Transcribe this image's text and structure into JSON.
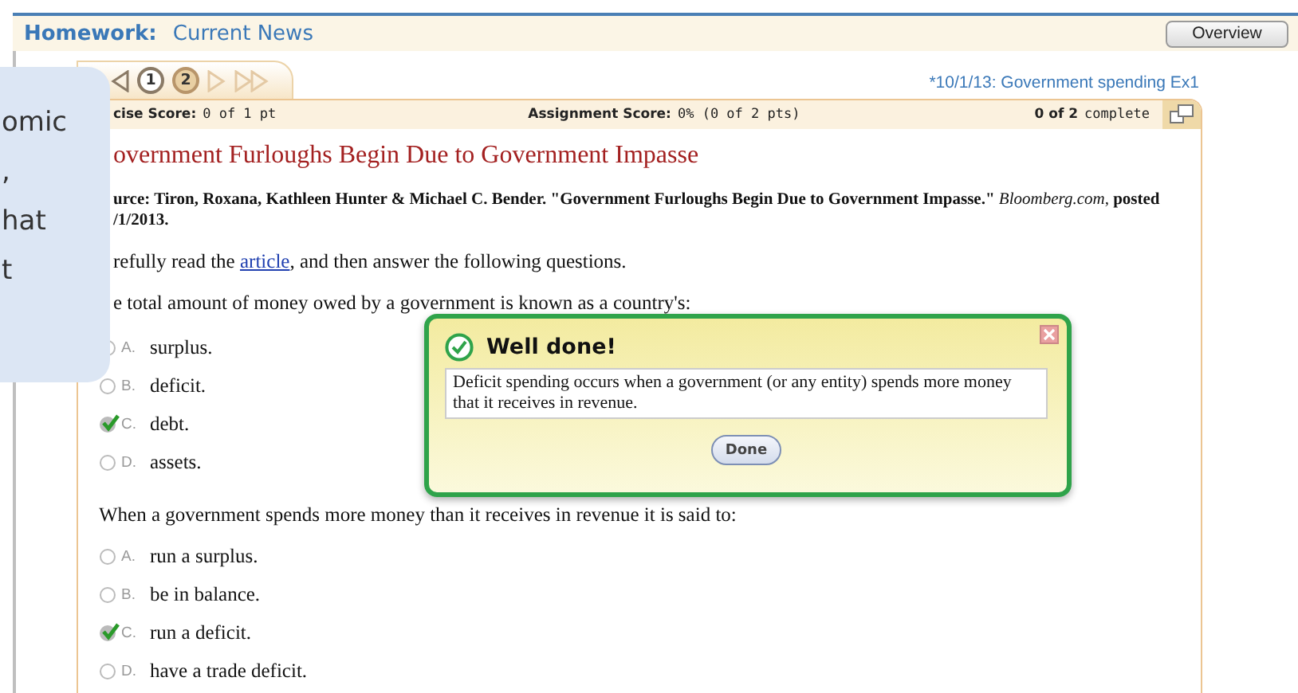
{
  "header": {
    "label": "Homework:",
    "title": "Current News",
    "button": "Overview"
  },
  "nav": {
    "pages": [
      {
        "label": "1",
        "selected": false
      },
      {
        "label": "2",
        "selected": true
      }
    ],
    "link": "*10/1/13: Government spending Ex1"
  },
  "score_bar": {
    "exercise_label": "cise Score:",
    "exercise_value": "0 of 1 pt",
    "assignment_label": "Assignment Score:",
    "assignment_value": "0% (0 of 2 pts)",
    "complete_count": "0 of 2",
    "complete_label": "complete"
  },
  "article": {
    "title": "overnment Furloughs Begin Due to Government Impasse",
    "source": "**urce: Tiron, Roxana, Kathleen Hunter & Michael C. Bender. \"Government Furloughs Begin Due to Government Impasse.\"** *Bloomberg.com*, **posted**",
    "source_date": "/1/2013.",
    "intro_before": "refully read the",
    "intro_link": "article",
    "intro_after": ", and then answer the following questions."
  },
  "questions": [
    {
      "prompt": "e total amount of money owed by a government is known as a country's:",
      "options": [
        {
          "letter": "A.",
          "text": "surplus.",
          "selected": false
        },
        {
          "letter": "B.",
          "text": "deficit.",
          "selected": false
        },
        {
          "letter": "C.",
          "text": "debt.",
          "selected": true
        },
        {
          "letter": "D.",
          "text": "assets.",
          "selected": false
        }
      ]
    },
    {
      "prompt": "When a government spends more money than it receives in revenue it is said to:",
      "options": [
        {
          "letter": "A.",
          "text": "run a surplus.",
          "selected": false
        },
        {
          "letter": "B.",
          "text": "be in balance.",
          "selected": false
        },
        {
          "letter": "C.",
          "text": "run a deficit.",
          "selected": true
        },
        {
          "letter": "D.",
          "text": "have a trade deficit.",
          "selected": false
        }
      ]
    }
  ],
  "feedback": {
    "title": "Well done!",
    "message": "Deficit spending occurs when a government (or any entity) spends more money that it receives in revenue.",
    "button": "Done"
  },
  "callout": {
    "lines": [
      "omic",
      ",",
      "hat",
      "t"
    ]
  }
}
